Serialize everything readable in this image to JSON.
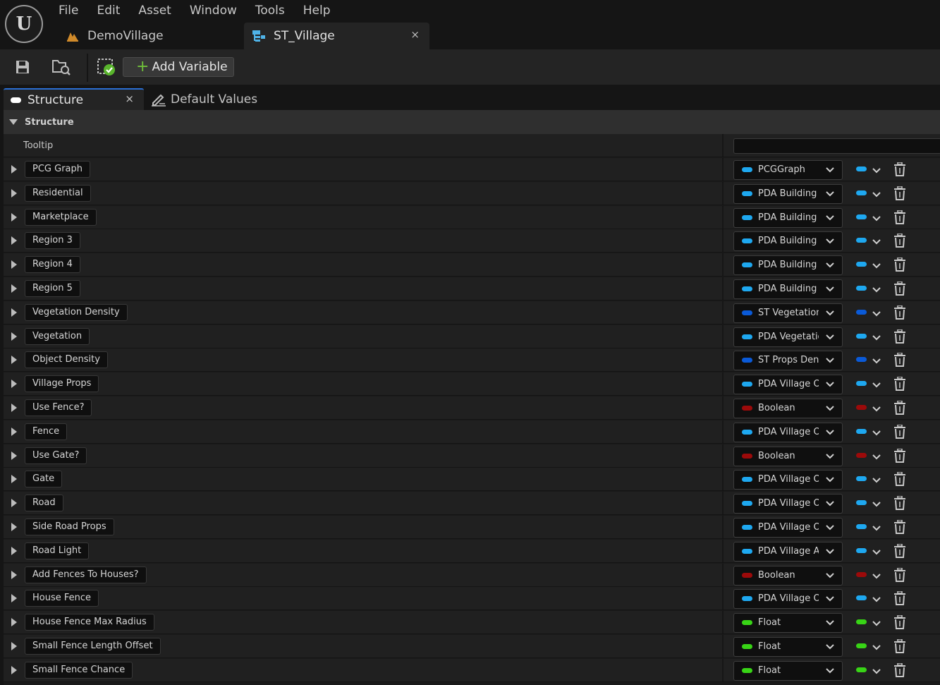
{
  "menu": {
    "items": [
      "File",
      "Edit",
      "Asset",
      "Window",
      "Tools",
      "Help"
    ]
  },
  "document_tabs": [
    {
      "label": "DemoVillage",
      "icon": "level-icon",
      "active": false
    },
    {
      "label": "ST_Village",
      "icon": "struct-icon",
      "active": true
    }
  ],
  "tab_close_glyph": "×",
  "toolbar": {
    "add_variable_label": "Add Variable",
    "add_variable_plus": "+"
  },
  "panel_tabs": [
    {
      "label": "Structure",
      "active": true
    },
    {
      "label": "Default Values",
      "active": false
    }
  ],
  "details": {
    "category": "Structure",
    "tooltip_label": "Tooltip",
    "tooltip_value": ""
  },
  "colors": {
    "object_ref": "#1ea8f0",
    "struct": "#0a5ad8",
    "boolean": "#9c0a0a",
    "float": "#38d416"
  },
  "variables": [
    {
      "name": "PCG Graph",
      "type": "PCGGraph",
      "color": "object_ref"
    },
    {
      "name": "Residential",
      "type": "PDA Building",
      "color": "object_ref"
    },
    {
      "name": "Marketplace",
      "type": "PDA Building",
      "color": "object_ref"
    },
    {
      "name": "Region 3",
      "type": "PDA Building",
      "color": "object_ref"
    },
    {
      "name": "Region 4",
      "type": "PDA Building",
      "color": "object_ref"
    },
    {
      "name": "Region 5",
      "type": "PDA Building",
      "color": "object_ref"
    },
    {
      "name": "Vegetation Density",
      "type": "ST Vegetation D",
      "color": "struct"
    },
    {
      "name": "Vegetation",
      "type": "PDA Vegetation",
      "color": "object_ref"
    },
    {
      "name": "Object Density",
      "type": "ST Props Dens",
      "color": "struct"
    },
    {
      "name": "Village Props",
      "type": "PDA Village Ob",
      "color": "object_ref"
    },
    {
      "name": "Use Fence?",
      "type": "Boolean",
      "color": "boolean"
    },
    {
      "name": "Fence",
      "type": "PDA Village Ob",
      "color": "object_ref"
    },
    {
      "name": "Use Gate?",
      "type": "Boolean",
      "color": "boolean"
    },
    {
      "name": "Gate",
      "type": "PDA Village Ob",
      "color": "object_ref"
    },
    {
      "name": "Road",
      "type": "PDA Village Ob",
      "color": "object_ref"
    },
    {
      "name": "Side Road Props",
      "type": "PDA Village Ob",
      "color": "object_ref"
    },
    {
      "name": "Road Light",
      "type": "PDA Village Act",
      "color": "object_ref"
    },
    {
      "name": "Add Fences To Houses?",
      "type": "Boolean",
      "color": "boolean"
    },
    {
      "name": "House Fence",
      "type": "PDA Village Ob",
      "color": "object_ref"
    },
    {
      "name": "House Fence Max Radius",
      "type": "Float",
      "color": "float"
    },
    {
      "name": "Small Fence Length Offset",
      "type": "Float",
      "color": "float"
    },
    {
      "name": "Small Fence Chance",
      "type": "Float",
      "color": "float"
    }
  ]
}
